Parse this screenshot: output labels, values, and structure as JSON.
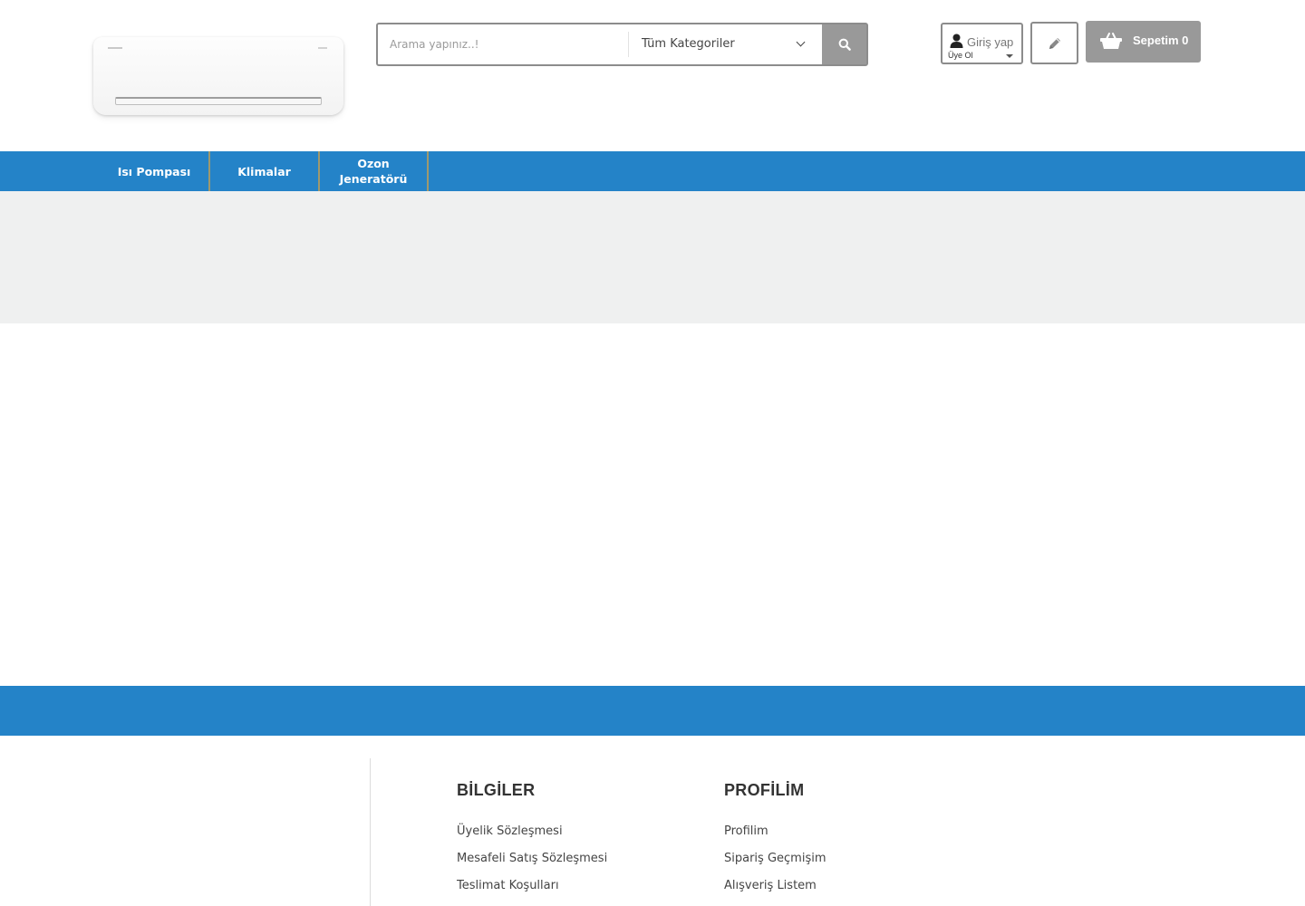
{
  "header": {
    "logo_icon": "air-conditioner-logo",
    "search": {
      "placeholder": "Arama yapınız..!",
      "value": "",
      "category_selected": "Tüm Kategoriler",
      "search_icon": "search-icon"
    },
    "account": {
      "login_label": "Giriş yap",
      "register_label": "Üye Ol",
      "user_icon": "user-icon"
    },
    "edit_icon": "pencil-icon",
    "cart": {
      "label": "Sepetim 0",
      "icon": "basket-icon"
    }
  },
  "nav": {
    "items": [
      {
        "label": "Isı Pompası"
      },
      {
        "label": "Klimalar"
      },
      {
        "label": "Ozon Jeneratörü"
      }
    ]
  },
  "footer": {
    "columns": [
      {
        "title": "BİLGİLER",
        "links": [
          "Üyelik Sözleşmesi",
          "Mesafeli Satış Sözleşmesi",
          "Teslimat Koşulları"
        ]
      },
      {
        "title": "PROFİLİM",
        "links": [
          "Profilim",
          "Sipariş Geçmişim",
          "Alışveriş Listem"
        ]
      }
    ]
  },
  "colors": {
    "primary_blue": "#2483c8",
    "button_gray": "#999999",
    "banner_gray": "#eff0f0",
    "nav_separator": "#c7a050"
  }
}
